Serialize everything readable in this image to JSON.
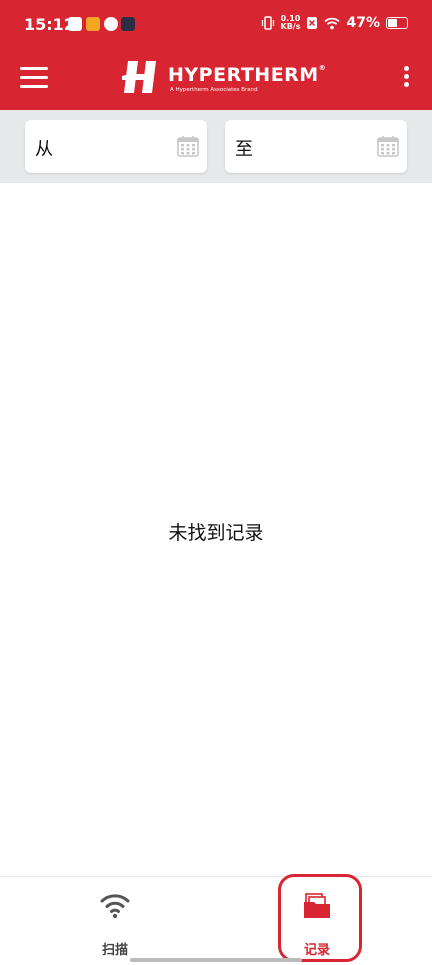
{
  "status_bar": {
    "time": "15:12",
    "net_speed_value": "0.10",
    "net_speed_unit": "KB/s",
    "battery_percent": "47%",
    "battery_level": 0.47
  },
  "header": {
    "brand": "HYPERTHERM",
    "brand_mark": "®",
    "tagline": "A Hypertherm Associates Brand",
    "menu_icon": "hamburger-icon",
    "more_icon": "kebab-icon"
  },
  "filters": {
    "from_label": "从",
    "to_label": "至",
    "icon": "calendar-icon"
  },
  "main": {
    "empty_message": "未找到记录"
  },
  "bottom_nav": {
    "tabs": [
      {
        "label": "扫描",
        "icon": "wifi-scan-icon",
        "active": false
      },
      {
        "label": "记录",
        "icon": "records-folder-icon",
        "active": true
      }
    ]
  },
  "colors": {
    "brand_red": "#d72631",
    "filter_bar_bg": "#e6e8ea",
    "inactive_tab": "#444444"
  }
}
